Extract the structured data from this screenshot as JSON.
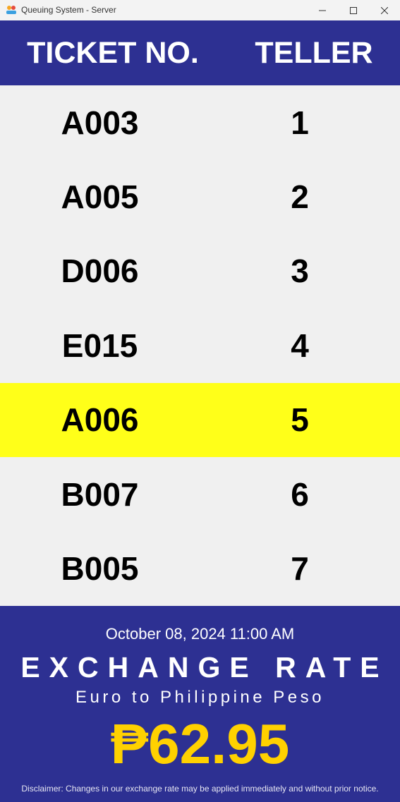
{
  "window": {
    "title": "Queuing System - Server",
    "icon": "queue-app-icon"
  },
  "header": {
    "ticket_label": "TICKET NO.",
    "teller_label": "TELLER"
  },
  "rows": [
    {
      "ticket": "A003",
      "teller": "1",
      "highlight": false
    },
    {
      "ticket": "A005",
      "teller": "2",
      "highlight": false
    },
    {
      "ticket": "D006",
      "teller": "3",
      "highlight": false
    },
    {
      "ticket": "E015",
      "teller": "4",
      "highlight": false
    },
    {
      "ticket": "A006",
      "teller": "5",
      "highlight": true
    },
    {
      "ticket": "B007",
      "teller": "6",
      "highlight": false
    },
    {
      "ticket": "B005",
      "teller": "7",
      "highlight": false
    }
  ],
  "footer": {
    "datetime": "October 08, 2024 11:00 AM",
    "title": "EXCHANGE RATE",
    "subtitle": "Euro to Philippine Peso",
    "rate": "₱62.95",
    "disclaimer": "Disclaimer: Changes in our exchange rate may be applied immediately and without prior notice."
  },
  "colors": {
    "header_bg": "#2d3092",
    "highlight": "#ffff19",
    "rate_color": "#ffd100",
    "row_bg": "#f0f0f0"
  }
}
